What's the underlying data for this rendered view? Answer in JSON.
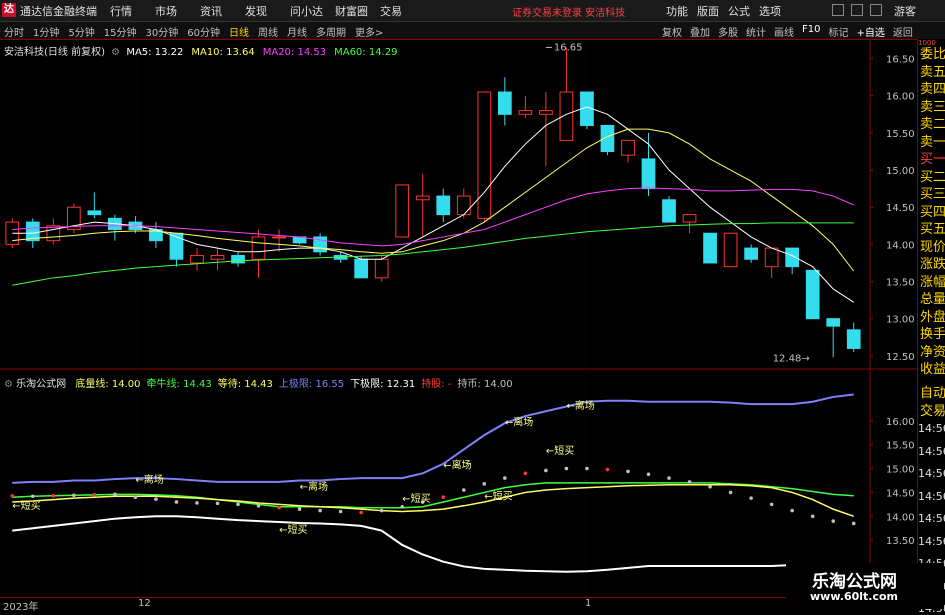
{
  "app": {
    "logo": "达",
    "name": "通达信金融终端",
    "menu": [
      "行情",
      "市场",
      "资讯",
      "发现",
      "问小达",
      "财富圈",
      "交易"
    ],
    "notice": "证券交易未登录  安洁科技",
    "right_menu": [
      "功能",
      "版面",
      "公式",
      "选项"
    ],
    "guest": "游客"
  },
  "toolbar": {
    "tabs": [
      "分时",
      "1分钟",
      "5分钟",
      "15分钟",
      "30分钟",
      "60分钟",
      "日线",
      "周线",
      "月线",
      "多周期",
      "更多>"
    ],
    "active_tab": "日线",
    "right_tools": [
      "复权",
      "叠加",
      "多股",
      "统计",
      "画线",
      "F10",
      "标记",
      "+自选",
      "返回"
    ]
  },
  "main_info": {
    "title": "安洁科技(日线 前复权)",
    "ma": [
      {
        "label": "MA5: 13.22",
        "color": "#ffffff"
      },
      {
        "label": "MA10: 13.64",
        "color": "#ffff66"
      },
      {
        "label": "MA20: 14.53",
        "color": "#ff40ff"
      },
      {
        "label": "MA60: 14.29",
        "color": "#40ff40"
      }
    ]
  },
  "sub_info": {
    "title": "乐淘公式网",
    "items": [
      {
        "label": "底量线: 14.00",
        "color": "#ffff66"
      },
      {
        "label": "牵牛线: 14.43",
        "color": "#40ff40"
      },
      {
        "label": "等待: 14.43",
        "color": "#ffff66"
      },
      {
        "label": "上极限: 16.55",
        "color": "#8080ff"
      },
      {
        "label": "下极限: 12.31",
        "color": "#ffffff"
      },
      {
        "label": "持股: -",
        "color": "#ff4040"
      },
      {
        "label": "持币: 14.00",
        "color": "#c0c0c0"
      }
    ]
  },
  "right_panel": {
    "upper": [
      "委比",
      "卖五",
      "卖四",
      "卖三",
      "卖二",
      "卖一",
      "买一",
      "买二",
      "买三",
      "买四",
      "买五",
      "现价",
      "涨跌",
      "涨幅",
      "总量",
      "外盘",
      "换手",
      "净资",
      "收益"
    ],
    "upper_red": [
      "买一"
    ],
    "lower": [
      "自动",
      "交易"
    ],
    "lower_vals": [
      "14:56",
      "14:56",
      "14:56",
      "14:56",
      "14:56",
      "14:56",
      "14:56",
      "14:56",
      "14:56"
    ],
    "top_val": "1000"
  },
  "chart_data": [
    {
      "type": "candlestick",
      "title": "安洁科技(日线 前复权)",
      "ylim": [
        12.35,
        16.75
      ],
      "yticks": [
        12.5,
        13.0,
        13.5,
        14.0,
        14.5,
        15.0,
        15.5,
        16.0,
        16.5
      ],
      "ytick_labels": [
        "12.50",
        "13.00",
        "13.50",
        "14.00",
        "14.50",
        "15.00",
        "15.50",
        "16.00",
        "16.50"
      ],
      "annotations": [
        {
          "text": "16.65",
          "value": 16.65,
          "index": 26
        },
        {
          "text": "12.48→",
          "value": 12.48,
          "index": 39
        }
      ],
      "candles": [
        {
          "o": 14.0,
          "h": 14.35,
          "l": 13.95,
          "c": 14.3
        },
        {
          "o": 14.3,
          "h": 14.35,
          "l": 13.95,
          "c": 14.05
        },
        {
          "o": 14.05,
          "h": 14.35,
          "l": 14.0,
          "c": 14.25
        },
        {
          "o": 14.2,
          "h": 14.55,
          "l": 14.15,
          "c": 14.5
        },
        {
          "o": 14.45,
          "h": 14.7,
          "l": 14.35,
          "c": 14.4
        },
        {
          "o": 14.35,
          "h": 14.4,
          "l": 14.05,
          "c": 14.2
        },
        {
          "o": 14.3,
          "h": 14.38,
          "l": 14.15,
          "c": 14.2
        },
        {
          "o": 14.2,
          "h": 14.3,
          "l": 13.95,
          "c": 14.05
        },
        {
          "o": 14.15,
          "h": 14.15,
          "l": 13.7,
          "c": 13.8
        },
        {
          "o": 13.75,
          "h": 13.95,
          "l": 13.65,
          "c": 13.85
        },
        {
          "o": 13.8,
          "h": 13.95,
          "l": 13.65,
          "c": 13.85
        },
        {
          "o": 13.85,
          "h": 13.9,
          "l": 13.7,
          "c": 13.75
        },
        {
          "o": 13.8,
          "h": 14.2,
          "l": 13.55,
          "c": 14.1
        },
        {
          "o": 14.1,
          "h": 14.2,
          "l": 13.9,
          "c": 14.1
        },
        {
          "o": 14.1,
          "h": 14.1,
          "l": 14.0,
          "c": 14.02
        },
        {
          "o": 14.1,
          "h": 14.15,
          "l": 13.85,
          "c": 13.9
        },
        {
          "o": 13.85,
          "h": 13.9,
          "l": 13.75,
          "c": 13.8
        },
        {
          "o": 13.8,
          "h": 13.85,
          "l": 13.55,
          "c": 13.55
        },
        {
          "o": 13.55,
          "h": 13.85,
          "l": 13.5,
          "c": 13.8
        },
        {
          "o": 14.1,
          "h": 14.8,
          "l": 14.1,
          "c": 14.8
        },
        {
          "o": 14.6,
          "h": 14.95,
          "l": 14.1,
          "c": 14.65
        },
        {
          "o": 14.65,
          "h": 14.75,
          "l": 14.3,
          "c": 14.4
        },
        {
          "o": 14.4,
          "h": 14.75,
          "l": 14.35,
          "c": 14.65
        },
        {
          "o": 14.35,
          "h": 16.05,
          "l": 14.3,
          "c": 16.05
        },
        {
          "o": 16.05,
          "h": 16.25,
          "l": 15.6,
          "c": 15.75
        },
        {
          "o": 15.75,
          "h": 16.0,
          "l": 15.7,
          "c": 15.8
        },
        {
          "o": 15.75,
          "h": 16.05,
          "l": 15.05,
          "c": 15.8
        },
        {
          "o": 15.4,
          "h": 16.65,
          "l": 15.4,
          "c": 16.05
        },
        {
          "o": 16.05,
          "h": 16.05,
          "l": 15.55,
          "c": 15.6
        },
        {
          "o": 15.6,
          "h": 15.6,
          "l": 15.2,
          "c": 15.25
        },
        {
          "o": 15.2,
          "h": 15.35,
          "l": 15.1,
          "c": 15.4
        },
        {
          "o": 15.15,
          "h": 15.5,
          "l": 14.65,
          "c": 14.75
        },
        {
          "o": 14.6,
          "h": 14.65,
          "l": 14.3,
          "c": 14.3
        },
        {
          "o": 14.3,
          "h": 14.4,
          "l": 14.15,
          "c": 14.4
        },
        {
          "o": 14.15,
          "h": 14.15,
          "l": 13.75,
          "c": 13.75
        },
        {
          "o": 13.7,
          "h": 14.15,
          "l": 13.7,
          "c": 14.15
        },
        {
          "o": 13.95,
          "h": 14.0,
          "l": 13.75,
          "c": 13.8
        },
        {
          "o": 13.7,
          "h": 13.95,
          "l": 13.55,
          "c": 13.95
        },
        {
          "o": 13.95,
          "h": 13.95,
          "l": 13.6,
          "c": 13.7
        },
        {
          "o": 13.65,
          "h": 13.65,
          "l": 13.0,
          "c": 13.0
        },
        {
          "o": 13.0,
          "h": 13.0,
          "l": 12.48,
          "c": 12.9
        },
        {
          "o": 12.85,
          "h": 12.95,
          "l": 12.55,
          "c": 12.6
        }
      ],
      "ma": {
        "MA5": [
          14.15,
          14.15,
          14.2,
          14.25,
          14.3,
          14.28,
          14.25,
          14.2,
          14.1,
          14.0,
          13.95,
          13.9,
          13.9,
          13.93,
          13.95,
          13.95,
          13.9,
          13.8,
          13.8,
          13.95,
          14.1,
          14.25,
          14.4,
          14.7,
          15.05,
          15.35,
          15.6,
          15.75,
          15.85,
          15.75,
          15.55,
          15.35,
          15.0,
          14.75,
          14.5,
          14.3,
          14.1,
          13.95,
          13.85,
          13.7,
          13.4,
          13.22
        ],
        "MA10": [
          14.05,
          14.08,
          14.1,
          14.12,
          14.15,
          14.17,
          14.18,
          14.18,
          14.15,
          14.12,
          14.08,
          14.05,
          14.02,
          14.0,
          13.98,
          13.95,
          13.93,
          13.9,
          13.88,
          13.9,
          13.98,
          14.05,
          14.15,
          14.3,
          14.5,
          14.7,
          14.9,
          15.1,
          15.3,
          15.45,
          15.55,
          15.55,
          15.5,
          15.35,
          15.15,
          15.0,
          14.85,
          14.65,
          14.45,
          14.25,
          14.0,
          13.64
        ],
        "MA20": [
          14.2,
          14.22,
          14.23,
          14.24,
          14.25,
          14.25,
          14.25,
          14.24,
          14.22,
          14.2,
          14.18,
          14.16,
          14.14,
          14.12,
          14.1,
          14.06,
          14.02,
          14.0,
          13.98,
          14.0,
          14.05,
          14.1,
          14.15,
          14.2,
          14.3,
          14.4,
          14.5,
          14.6,
          14.68,
          14.72,
          14.75,
          14.76,
          14.75,
          14.74,
          14.72,
          14.72,
          14.73,
          14.74,
          14.74,
          14.72,
          14.65,
          14.53
        ],
        "MA60": [
          13.45,
          13.5,
          13.55,
          13.58,
          13.62,
          13.65,
          13.68,
          13.7,
          13.72,
          13.74,
          13.76,
          13.78,
          13.79,
          13.8,
          13.81,
          13.82,
          13.83,
          13.84,
          13.85,
          13.87,
          13.9,
          13.93,
          13.96,
          14.0,
          14.04,
          14.08,
          14.11,
          14.14,
          14.17,
          14.19,
          14.21,
          14.23,
          14.25,
          14.26,
          14.27,
          14.28,
          14.28,
          14.29,
          14.29,
          14.29,
          14.29,
          14.29
        ]
      }
    },
    {
      "type": "line",
      "title": "乐淘公式网",
      "ylim": [
        12.31,
        16.75
      ],
      "yticks": [
        13.5,
        14.0,
        14.5,
        15.0,
        15.5,
        16.0
      ],
      "ytick_labels": [
        "13.50",
        "14.00",
        "14.50",
        "15.00",
        "15.50",
        "16.00"
      ],
      "series": [
        {
          "name": "上极限",
          "color": "#8080ff",
          "values": [
            14.7,
            14.72,
            14.72,
            14.75,
            14.75,
            14.78,
            14.8,
            14.8,
            14.78,
            14.75,
            14.72,
            14.72,
            14.72,
            14.72,
            14.75,
            14.75,
            14.78,
            14.8,
            14.8,
            14.8,
            14.9,
            15.1,
            15.4,
            15.7,
            15.95,
            16.1,
            16.2,
            16.3,
            16.4,
            16.42,
            16.42,
            16.4,
            16.4,
            16.4,
            16.4,
            16.38,
            16.35,
            16.35,
            16.35,
            16.4,
            16.5,
            16.55
          ]
        },
        {
          "name": "牵牛线",
          "color": "#40ff40",
          "values": [
            14.4,
            14.42,
            14.43,
            14.44,
            14.45,
            14.46,
            14.46,
            14.45,
            14.43,
            14.4,
            14.35,
            14.3,
            14.25,
            14.2,
            14.2,
            14.2,
            14.2,
            14.18,
            14.18,
            14.18,
            14.2,
            14.3,
            14.4,
            14.5,
            14.6,
            14.66,
            14.7,
            14.7,
            14.7,
            14.7,
            14.7,
            14.7,
            14.7,
            14.7,
            14.7,
            14.68,
            14.66,
            14.62,
            14.58,
            14.52,
            14.46,
            14.43
          ]
        },
        {
          "name": "底量线",
          "color": "#ffff66",
          "values": [
            14.3,
            14.32,
            14.35,
            14.38,
            14.4,
            14.42,
            14.42,
            14.42,
            14.4,
            14.38,
            14.35,
            14.32,
            14.28,
            14.25,
            14.22,
            14.2,
            14.18,
            14.15,
            14.12,
            14.1,
            14.12,
            14.15,
            14.22,
            14.3,
            14.4,
            14.5,
            14.55,
            14.58,
            14.6,
            14.62,
            14.64,
            14.65,
            14.66,
            14.66,
            14.66,
            14.66,
            14.64,
            14.6,
            14.5,
            14.35,
            14.15,
            14.0
          ]
        },
        {
          "name": "下极限",
          "color": "#ffffff",
          "values": [
            13.7,
            13.75,
            13.8,
            13.85,
            13.9,
            13.95,
            13.98,
            14.0,
            14.0,
            13.98,
            13.95,
            13.92,
            13.9,
            13.88,
            13.86,
            13.85,
            13.83,
            13.8,
            13.7,
            13.4,
            13.2,
            13.05,
            12.95,
            12.9,
            12.88,
            12.86,
            12.85,
            12.84,
            12.85,
            12.88,
            12.92,
            12.96,
            12.96,
            12.96,
            12.96,
            12.96,
            12.96,
            12.96,
            12.98,
            12.98,
            12.98,
            12.98
          ]
        },
        {
          "name": "信号点",
          "color": "#c0c0c0",
          "values": [
            14.43,
            14.42,
            14.43,
            14.44,
            14.45,
            14.46,
            14.4,
            14.36,
            14.3,
            14.28,
            14.27,
            14.25,
            14.22,
            14.18,
            14.15,
            14.12,
            14.1,
            14.08,
            14.12,
            14.2,
            14.3,
            14.4,
            14.55,
            14.68,
            14.8,
            14.9,
            14.96,
            15.0,
            15.0,
            14.98,
            14.94,
            14.88,
            14.8,
            14.72,
            14.62,
            14.5,
            14.38,
            14.25,
            14.12,
            14.0,
            13.9,
            13.85
          ]
        }
      ],
      "annotations": [
        {
          "text": "←短买",
          "index": 0,
          "value": 14.15
        },
        {
          "text": "←离场",
          "index": 6,
          "value": 14.7
        },
        {
          "text": "←短买",
          "index": 13,
          "value": 13.65
        },
        {
          "text": "←离场",
          "index": 14,
          "value": 14.55
        },
        {
          "text": "←短买",
          "index": 19,
          "value": 14.3
        },
        {
          "text": "←离场",
          "index": 21,
          "value": 15.0
        },
        {
          "text": "←短买",
          "index": 23,
          "value": 14.35
        },
        {
          "text": "←离场",
          "index": 24,
          "value": 15.9
        },
        {
          "text": "←短买",
          "index": 26,
          "value": 15.3
        },
        {
          "text": "←离场",
          "index": 27,
          "value": 16.25
        }
      ]
    }
  ],
  "xaxis": {
    "labels": [
      "2023年",
      "12",
      "1"
    ]
  },
  "watermark": {
    "line1": "乐淘公式网",
    "line2": "www.60lt.com"
  }
}
